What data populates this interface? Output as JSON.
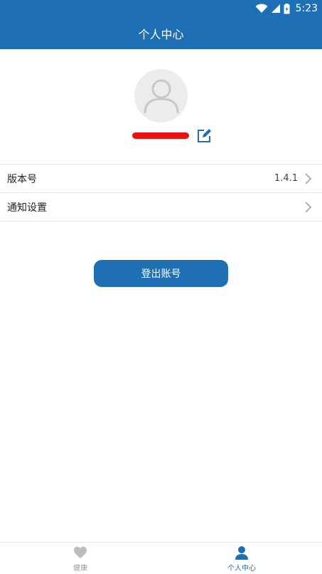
{
  "status_bar": {
    "time": "5:23",
    "icons": [
      "wifi-icon",
      "signal-icon",
      "battery-icon"
    ]
  },
  "header": {
    "title": "个人中心"
  },
  "profile": {
    "avatar_icon": "user-avatar-icon",
    "username": "",
    "edit_icon": "edit-icon"
  },
  "settings": {
    "items": [
      {
        "label": "版本号",
        "value": "1.4.1"
      },
      {
        "label": "通知设置",
        "value": ""
      }
    ]
  },
  "logout_label": "登出账号",
  "bottom_nav": {
    "items": [
      {
        "label": "健康",
        "icon": "heart-icon",
        "active": false
      },
      {
        "label": "个人中心",
        "icon": "person-icon",
        "active": true
      }
    ]
  },
  "colors": {
    "primary": "#1f6fb5",
    "redaction": "#ee1010",
    "inactive": "#9a9a9a"
  }
}
